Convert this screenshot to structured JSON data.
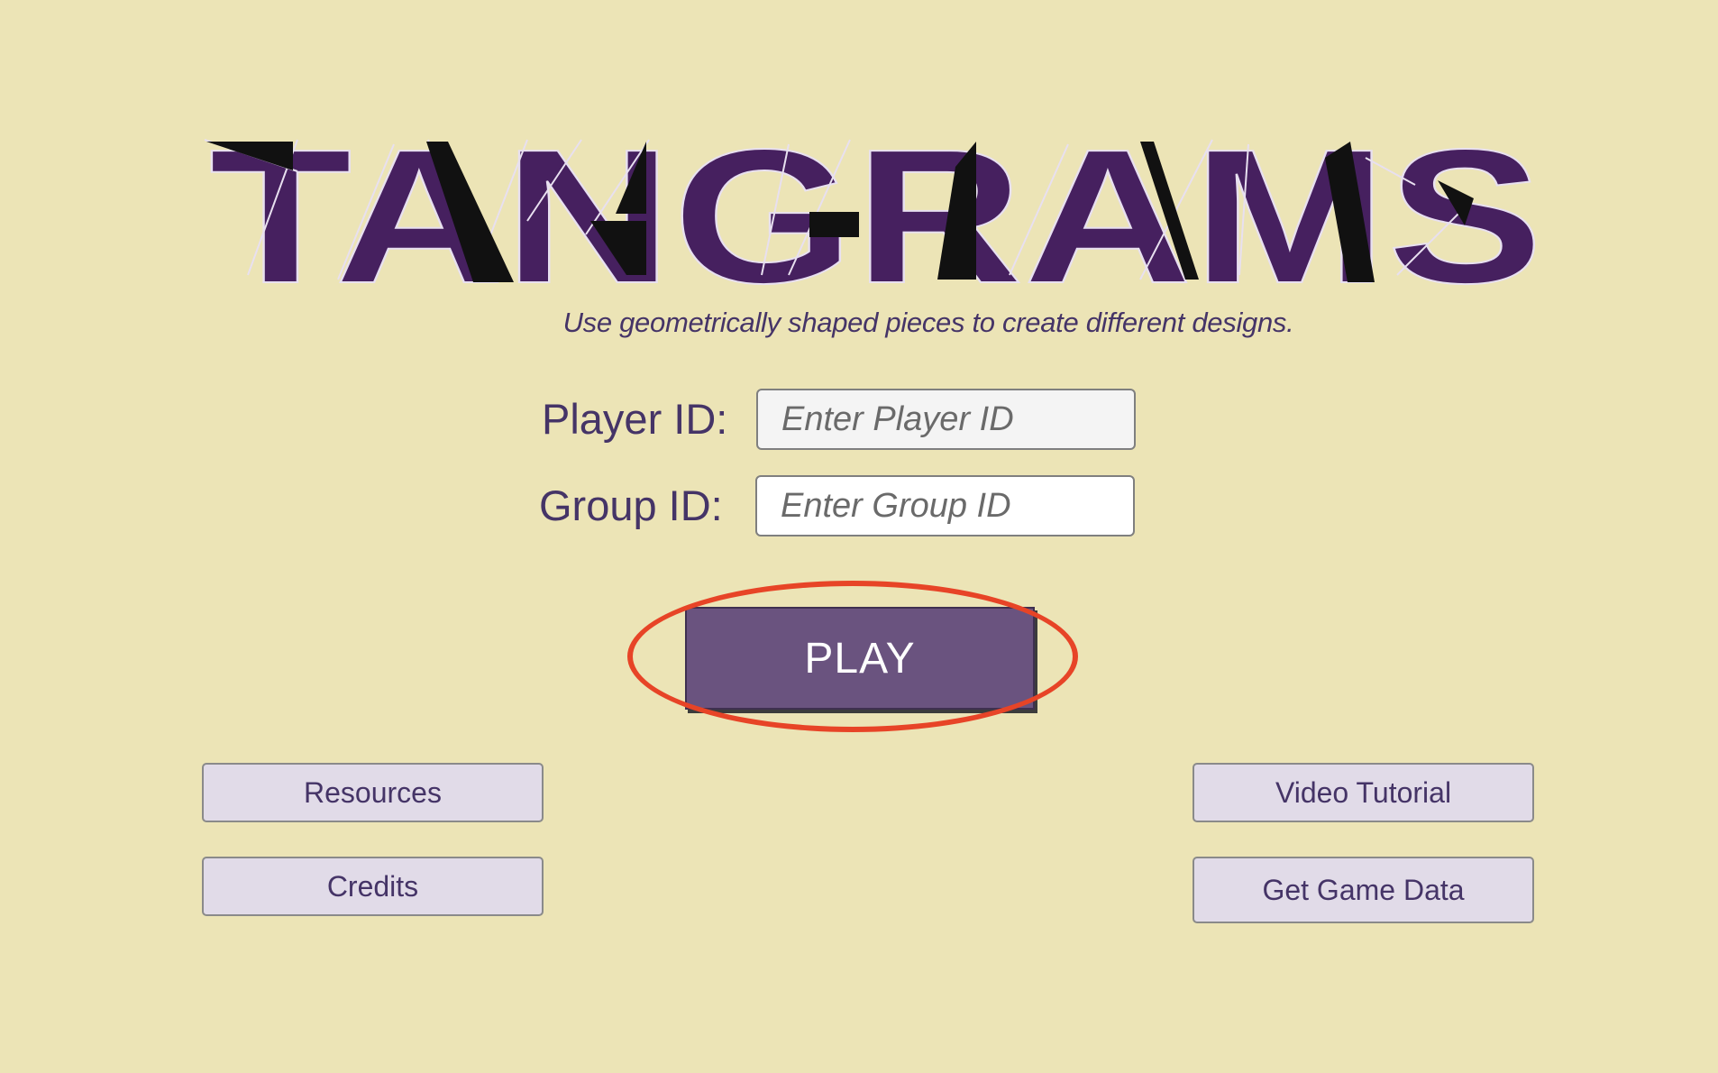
{
  "logo": {
    "text": "TANGRAMS",
    "colors": {
      "fill": "#46205f",
      "accent": "#111111",
      "outline": "#e8e0f0"
    }
  },
  "subtitle": "Use geometrically shaped pieces to create different designs.",
  "form": {
    "player": {
      "label": "Player ID:",
      "placeholder": "Enter Player ID",
      "value": ""
    },
    "group": {
      "label": "Group ID:",
      "placeholder": "Enter Group ID",
      "value": ""
    }
  },
  "play_button": {
    "label": "PLAY"
  },
  "links": {
    "resources": "Resources",
    "credits": "Credits",
    "video_tutorial": "Video Tutorial",
    "get_game_data": "Get Game Data"
  },
  "colors": {
    "background": "#ece4b6",
    "text_primary": "#453467",
    "play_button": "#6a537f",
    "secondary_button": "#e1dbe8",
    "highlight": "#e74427"
  }
}
